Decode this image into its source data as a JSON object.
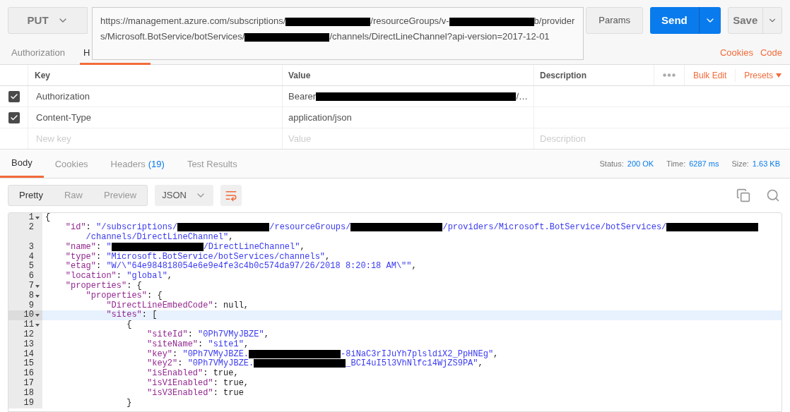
{
  "request": {
    "method": "PUT",
    "url_parts": [
      {
        "kind": "text",
        "text": "https://management.azure.com/subscriptions/"
      },
      {
        "kind": "redacted"
      },
      {
        "kind": "text",
        "text": "/resourceGroups/v-"
      },
      {
        "kind": "redacted"
      },
      {
        "kind": "text",
        "text": "b/providers/Microsoft.BotService/botServices/"
      },
      {
        "kind": "redacted"
      },
      {
        "kind": "text",
        "text": "/channels/DirectLineChannel?api-version=2017-12-01"
      }
    ],
    "params": "Params",
    "send": "Send",
    "save": "Save"
  },
  "request_tabs": [
    {
      "label": "Authorization",
      "selected": false
    },
    {
      "label": "H",
      "selected": true
    }
  ],
  "request_links": [
    "Cookies",
    "Code"
  ],
  "headers_table": {
    "columns": [
      "Key",
      "Value",
      "Description"
    ],
    "bulk_edit": "Bulk Edit",
    "presets": "Presets",
    "rows": [
      {
        "checked": true,
        "key": "Authorization",
        "value_parts": [
          {
            "kind": "text",
            "text": "Bearer "
          },
          {
            "kind": "redacted"
          },
          {
            "kind": "text",
            "text": "/…"
          }
        ]
      },
      {
        "checked": true,
        "key": "Content-Type",
        "value_parts": [
          {
            "kind": "text",
            "text": "application/json"
          }
        ]
      }
    ],
    "new_row": {
      "key_placeholder": "New key",
      "value_placeholder": "Value",
      "description_placeholder": "Description"
    }
  },
  "response_tabs": [
    {
      "label": "Body",
      "selected": true
    },
    {
      "label": "Cookies",
      "selected": false
    },
    {
      "label": "Headers",
      "count": "(19)",
      "selected": false
    },
    {
      "label": "Test Results",
      "selected": false
    }
  ],
  "response_meta": [
    {
      "label": "Status:",
      "value": "200 OK"
    },
    {
      "label": "Time:",
      "value": "6287 ms"
    },
    {
      "label": "Size:",
      "value": "1.63 KB"
    }
  ],
  "view_modes": [
    {
      "label": "Pretty",
      "selected": true
    },
    {
      "label": "Raw",
      "selected": false
    },
    {
      "label": "Preview",
      "selected": false
    }
  ],
  "format": "JSON",
  "code_lines": [
    {
      "number": "1",
      "foldable": true,
      "current": false,
      "parts": [
        {
          "kind": "plain",
          "text": "{"
        }
      ]
    },
    {
      "number": "2",
      "foldable": false,
      "current": false,
      "parts": [
        {
          "kind": "key",
          "text": "    \"id\""
        },
        {
          "kind": "plain",
          "text": ": "
        },
        {
          "kind": "string",
          "text": "\"/subscriptions/"
        },
        {
          "kind": "redacted"
        },
        {
          "kind": "string",
          "text": "/resourceGroups/"
        },
        {
          "kind": "redacted"
        },
        {
          "kind": "string",
          "text": "/providers/Microsoft.BotService/botServices/"
        },
        {
          "kind": "redacted"
        }
      ],
      "continuation": [
        {
          "kind": "string",
          "text": "        /channels/DirectLineChannel\""
        },
        {
          "kind": "plain",
          "text": ","
        }
      ]
    },
    {
      "number": "3",
      "foldable": false,
      "current": false,
      "parts": [
        {
          "kind": "key",
          "text": "    \"name\""
        },
        {
          "kind": "plain",
          "text": ": "
        },
        {
          "kind": "string",
          "text": "\""
        },
        {
          "kind": "redacted"
        },
        {
          "kind": "string",
          "text": "/DirectLineChannel\""
        },
        {
          "kind": "plain",
          "text": ","
        }
      ]
    },
    {
      "number": "4",
      "foldable": false,
      "current": false,
      "parts": [
        {
          "kind": "key",
          "text": "    \"type\""
        },
        {
          "kind": "plain",
          "text": ": "
        },
        {
          "kind": "string",
          "text": "\"Microsoft.BotService/botServices/channels\""
        },
        {
          "kind": "plain",
          "text": ","
        }
      ]
    },
    {
      "number": "5",
      "foldable": false,
      "current": false,
      "parts": [
        {
          "kind": "key",
          "text": "    \"etag\""
        },
        {
          "kind": "plain",
          "text": ": "
        },
        {
          "kind": "string",
          "text": "\"W/\\\"64e984818054e6e9e4fe3c4b0c574da97/26/2018 8:20:18 AM\\\"\""
        },
        {
          "kind": "plain",
          "text": ","
        }
      ]
    },
    {
      "number": "6",
      "foldable": false,
      "current": false,
      "parts": [
        {
          "kind": "key",
          "text": "    \"location\""
        },
        {
          "kind": "plain",
          "text": ": "
        },
        {
          "kind": "string",
          "text": "\"global\""
        },
        {
          "kind": "plain",
          "text": ","
        }
      ]
    },
    {
      "number": "7",
      "foldable": true,
      "current": false,
      "parts": [
        {
          "kind": "key",
          "text": "    \"properties\""
        },
        {
          "kind": "plain",
          "text": ": {"
        }
      ]
    },
    {
      "number": "8",
      "foldable": true,
      "current": false,
      "parts": [
        {
          "kind": "key",
          "text": "        \"properties\""
        },
        {
          "kind": "plain",
          "text": ": {"
        }
      ]
    },
    {
      "number": "9",
      "foldable": false,
      "current": false,
      "parts": [
        {
          "kind": "key",
          "text": "            \"DirectLineEmbedCode\""
        },
        {
          "kind": "plain",
          "text": ": null,"
        }
      ]
    },
    {
      "number": "10",
      "foldable": true,
      "current": true,
      "parts": [
        {
          "kind": "key",
          "text": "            \"sites\""
        },
        {
          "kind": "plain",
          "text": ": ["
        }
      ]
    },
    {
      "number": "11",
      "foldable": true,
      "current": false,
      "parts": [
        {
          "kind": "plain",
          "text": "                {"
        }
      ]
    },
    {
      "number": "12",
      "foldable": false,
      "current": false,
      "parts": [
        {
          "kind": "key",
          "text": "                    \"siteId\""
        },
        {
          "kind": "plain",
          "text": ": "
        },
        {
          "kind": "string",
          "text": "\"0Ph7VMyJBZE\""
        },
        {
          "kind": "plain",
          "text": ","
        }
      ]
    },
    {
      "number": "13",
      "foldable": false,
      "current": false,
      "parts": [
        {
          "kind": "key",
          "text": "                    \"siteName\""
        },
        {
          "kind": "plain",
          "text": ": "
        },
        {
          "kind": "string",
          "text": "\"site1\""
        },
        {
          "kind": "plain",
          "text": ","
        }
      ]
    },
    {
      "number": "14",
      "foldable": false,
      "current": false,
      "parts": [
        {
          "kind": "key",
          "text": "                    \"key\""
        },
        {
          "kind": "plain",
          "text": ": "
        },
        {
          "kind": "string",
          "text": "\"0Ph7VMyJBZE."
        },
        {
          "kind": "redacted"
        },
        {
          "kind": "string",
          "text": "-8iNaC3rIJuYh7plsldiX2_PpHNEg\""
        },
        {
          "kind": "plain",
          "text": ","
        }
      ]
    },
    {
      "number": "15",
      "foldable": false,
      "current": false,
      "parts": [
        {
          "kind": "key",
          "text": "                    \"key2\""
        },
        {
          "kind": "plain",
          "text": ": "
        },
        {
          "kind": "string",
          "text": "\"0Ph7VMyJBZE."
        },
        {
          "kind": "redacted"
        },
        {
          "kind": "string",
          "text": "_BCI4uI5l3VhNlfc14WjZS9PA\""
        },
        {
          "kind": "plain",
          "text": ","
        }
      ]
    },
    {
      "number": "16",
      "foldable": false,
      "current": false,
      "parts": [
        {
          "kind": "key",
          "text": "                    \"isEnabled\""
        },
        {
          "kind": "plain",
          "text": ": true,"
        }
      ]
    },
    {
      "number": "17",
      "foldable": false,
      "current": false,
      "parts": [
        {
          "kind": "key",
          "text": "                    \"isV1Enabled\""
        },
        {
          "kind": "plain",
          "text": ": true,"
        }
      ]
    },
    {
      "number": "18",
      "foldable": false,
      "current": false,
      "parts": [
        {
          "kind": "key",
          "text": "                    \"isV3Enabled\""
        },
        {
          "kind": "plain",
          "text": ": true"
        }
      ]
    },
    {
      "number": "19",
      "foldable": false,
      "current": false,
      "parts": [
        {
          "kind": "plain",
          "text": "                }"
        }
      ]
    }
  ]
}
